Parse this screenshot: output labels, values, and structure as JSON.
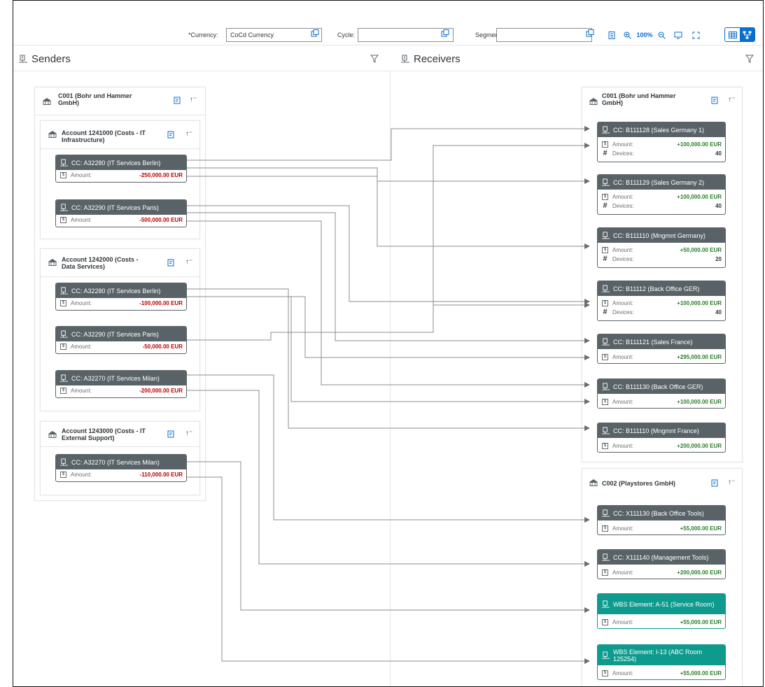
{
  "toolbar": {
    "currency_label": "*Currency:",
    "currency_value": "CoCd Currency",
    "cycle_label": "Cycle:",
    "cycle_value": "",
    "segment_label": "Segment:",
    "segment_value": "",
    "zoom_level": "100%"
  },
  "senders": {
    "title": "Senders",
    "company": "C001 (Bohr und Hammer GmbH)",
    "accounts": [
      {
        "title": "Account 1241000 (Costs - IT Infrastructure)",
        "nodes": [
          {
            "title": "CC: A32280 (IT Services Berlin)",
            "amount_label": "Amount:",
            "amount": "-250,000.00 EUR"
          },
          {
            "title": "CC: A32290 (IT Services Paris)",
            "amount_label": "Amount:",
            "amount": "-500,000.00 EUR"
          }
        ]
      },
      {
        "title": "Account 1242000 (Costs - Data Services)",
        "nodes": [
          {
            "title": "CC: A32280 (IT Services Berlin)",
            "amount_label": "Amount:",
            "amount": "-100,000.00 EUR"
          },
          {
            "title": "CC: A32290 (IT Services Paris)",
            "amount_label": "Amount:",
            "amount": "-50,000.00 EUR"
          },
          {
            "title": "CC: A32270 (IT Services Milan)",
            "amount_label": "Amount:",
            "amount": "-200,000.00 EUR"
          }
        ]
      },
      {
        "title": "Account 1243000 (Costs - IT External Support)",
        "nodes": [
          {
            "title": "CC: A32270 (IT Services Milan)",
            "amount_label": "Amount:",
            "amount": "-110,000.00 EUR"
          }
        ]
      }
    ]
  },
  "receivers": {
    "title": "Receivers",
    "companies": [
      {
        "title": "C001 (Bohr und Hammer GmbH)",
        "nodes": [
          {
            "title": "CC: B111128 (Sales Germany 1)",
            "amount_label": "Amount:",
            "amount": "+100,000.00 EUR",
            "devices_label": "Devices:",
            "devices": "40"
          },
          {
            "title": "CC: B111129 (Sales Germany 2)",
            "amount_label": "Amount:",
            "amount": "+100,000.00 EUR",
            "devices_label": "Devices:",
            "devices": "40"
          },
          {
            "title": "CC: B111110 (Mngmnt Germany)",
            "amount_label": "Amount:",
            "amount": "+50,000.00 EUR",
            "devices_label": "Devices:",
            "devices": "20"
          },
          {
            "title": "CC: B11112 (Back Office GER)",
            "amount_label": "Amount:",
            "amount": "+100,000.00 EUR",
            "devices_label": "Devices:",
            "devices": "40"
          },
          {
            "title": "CC: B111121 (Sales France)",
            "amount_label": "Amount:",
            "amount": "+295,000.00 EUR"
          },
          {
            "title": "CC: B111130 (Back Office GER)",
            "amount_label": "Amount:",
            "amount": "+100,000.00 EUR"
          },
          {
            "title": "CC: B111110 (Mngmnt France)",
            "amount_label": "Amount:",
            "amount": "+200,000.00 EUR"
          }
        ]
      },
      {
        "title": "C002 (Playstores GmbH)",
        "nodes": [
          {
            "title": "CC: X111130 (Back Office Tools)",
            "amount_label": "Amount:",
            "amount": "+55,000.00 EUR"
          },
          {
            "title": "CC: X111140 (Management Tools)",
            "amount_label": "Amount:",
            "amount": "+200,000.00 EUR"
          },
          {
            "title": "WBS Element: A-51 (Service Room)",
            "amount_label": "Amount:",
            "amount": "+55,000.00 EUR"
          },
          {
            "title": "WBS Element: I-13 (ABC Room 125254)",
            "amount_label": "Amount:",
            "amount": "+55,000.00 EUR"
          }
        ]
      }
    ]
  },
  "colors": {
    "node_header": "#596267",
    "wbs_header": "#0e9b8e",
    "negative": "#bb0000",
    "positive": "#2b7d2b",
    "accent": "#0a6ed1"
  }
}
